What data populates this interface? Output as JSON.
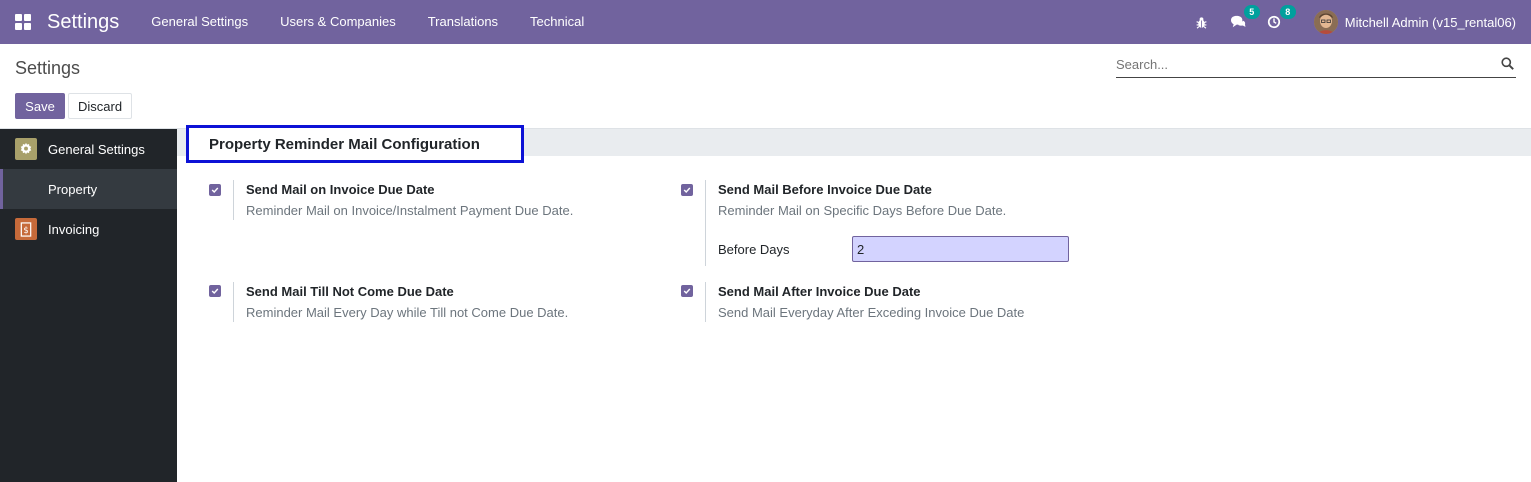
{
  "navbar": {
    "app_title": "Settings",
    "menu": [
      "General Settings",
      "Users & Companies",
      "Translations",
      "Technical"
    ],
    "messages_badge": "5",
    "activities_badge": "8",
    "user_name": "Mitchell Admin (v15_rental06)"
  },
  "control_panel": {
    "breadcrumb": "Settings",
    "search_placeholder": "Search...",
    "save_label": "Save",
    "discard_label": "Discard"
  },
  "sidebar": {
    "items": [
      {
        "label": "General Settings",
        "icon": "gear-icon"
      },
      {
        "label": "Property"
      },
      {
        "label": "Invoicing",
        "icon": "invoice-icon"
      }
    ]
  },
  "section": {
    "title": "Property Reminder Mail Configuration"
  },
  "settings": [
    {
      "label": "Send Mail on Invoice Due Date",
      "desc": "Reminder Mail on Invoice/Instalment Payment Due Date.",
      "checked": true
    },
    {
      "label": "Send Mail Before Invoice Due Date",
      "desc": "Reminder Mail on Specific Days Before Due Date.",
      "checked": true,
      "field_label": "Before Days",
      "field_value": "2"
    },
    {
      "label": "Send Mail Till Not Come Due Date",
      "desc": "Reminder Mail Every Day while Till not Come Due Date.",
      "checked": true
    },
    {
      "label": "Send Mail After Invoice Due Date",
      "desc": "Send Mail Everyday After Exceding Invoice Due Date",
      "checked": true
    }
  ],
  "colors": {
    "brand": "#71639e",
    "badge": "#00a09d",
    "sidebar": "#212529",
    "highlight": "#0d12d6"
  }
}
